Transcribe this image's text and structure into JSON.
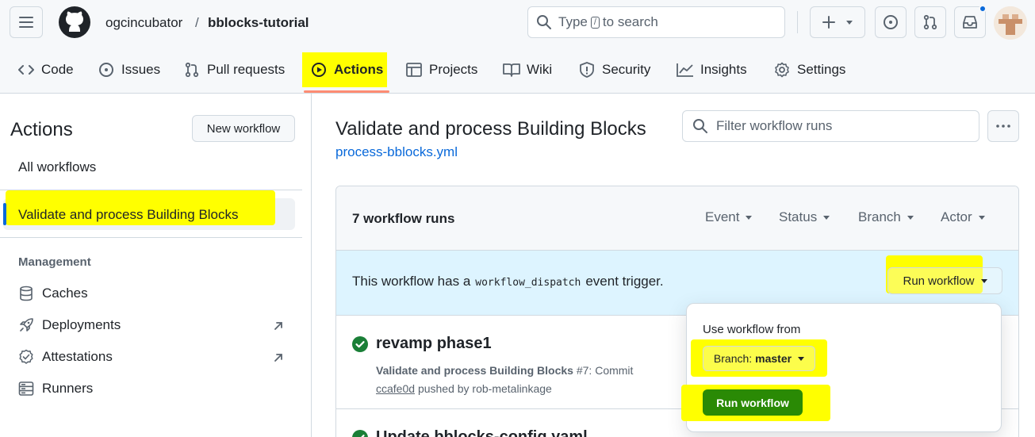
{
  "header": {
    "owner": "ogcincubator",
    "separator": "/",
    "repo": "bblocks-tutorial",
    "search_before": "Type",
    "search_key": "/",
    "search_after": "to search"
  },
  "tabs": [
    {
      "label": "Code",
      "icon": "code-icon"
    },
    {
      "label": "Issues",
      "icon": "issue-icon"
    },
    {
      "label": "Pull requests",
      "icon": "pull-request-icon"
    },
    {
      "label": "Actions",
      "icon": "play-icon",
      "selected": true
    },
    {
      "label": "Projects",
      "icon": "table-icon"
    },
    {
      "label": "Wiki",
      "icon": "book-icon"
    },
    {
      "label": "Security",
      "icon": "shield-icon"
    },
    {
      "label": "Insights",
      "icon": "graph-icon"
    },
    {
      "label": "Settings",
      "icon": "gear-icon"
    }
  ],
  "sidebar": {
    "title": "Actions",
    "new_workflow": "New workflow",
    "all_workflows": "All workflows",
    "selected_workflow": "Validate and process Building Blocks",
    "management_heading": "Management",
    "management_items": [
      {
        "label": "Caches",
        "icon": "database-icon"
      },
      {
        "label": "Deployments",
        "icon": "rocket-icon",
        "external": true
      },
      {
        "label": "Attestations",
        "icon": "verified-icon",
        "external": true
      },
      {
        "label": "Runners",
        "icon": "server-icon"
      }
    ]
  },
  "main": {
    "title": "Validate and process Building Blocks",
    "workflow_file": "process-bblocks.yml",
    "filter_placeholder": "Filter workflow runs",
    "runs_count": "7 workflow runs",
    "filters": [
      "Event",
      "Status",
      "Branch",
      "Actor"
    ],
    "notice_prefix": "This workflow has a",
    "notice_code": "workflow_dispatch",
    "notice_suffix": "event trigger.",
    "run_workflow_button": "Run workflow",
    "runs": [
      {
        "title": "revamp phase1",
        "workflow": "Validate and process Building Blocks",
        "number": "#7: Commit",
        "commit": "ccafe0d",
        "pushed_by": "pushed by rob-metalinkage",
        "status": "success"
      },
      {
        "title": "Update bblocks-config.yaml",
        "status": "success"
      }
    ]
  },
  "dropdown": {
    "label": "Use workflow from",
    "branch_prefix": "Branch:",
    "branch": "master",
    "submit": "Run workflow"
  },
  "colors": {
    "highlight": "#ffff00",
    "link": "#0969da",
    "success": "#1a7f37",
    "primary_button": "#1f883d",
    "notice_bg": "#ddf4ff",
    "tab_underline": "#fd8c73"
  }
}
